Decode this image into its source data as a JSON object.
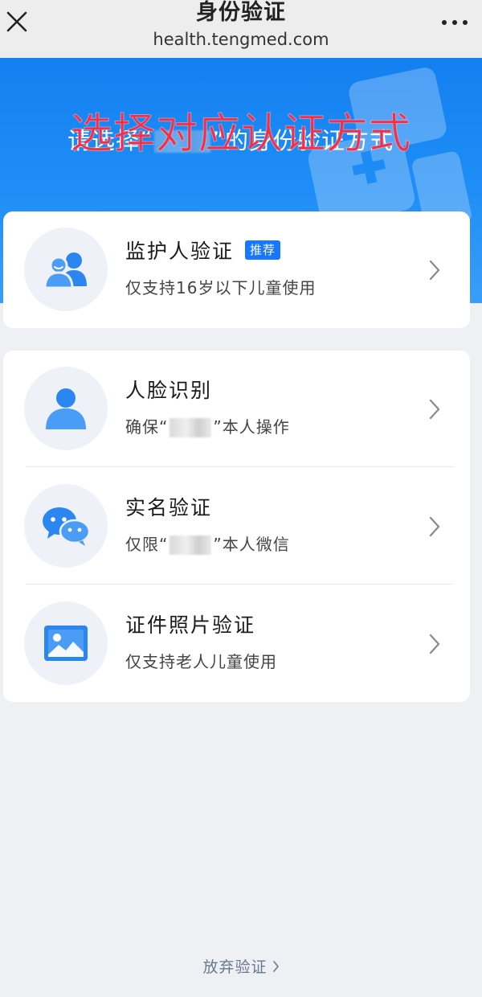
{
  "nav": {
    "title": "身份验证",
    "url": "health.tengmed.com"
  },
  "banner": {
    "subtitle_pre": "请选择“",
    "subtitle_post": "”的身份验证方式",
    "overlay_text": "选择对应认证方式"
  },
  "options": [
    {
      "title": "监护人验证",
      "badge": "推荐",
      "desc": "仅支持16岁以下儿童使用",
      "icon": "guardian-icon"
    },
    {
      "title": "人脸识别",
      "desc_pre": "确保“",
      "desc_post": "”本人操作",
      "icon": "face-icon"
    },
    {
      "title": "实名验证",
      "desc_pre": "仅限“",
      "desc_post": "”本人微信",
      "icon": "wechat-icon"
    },
    {
      "title": "证件照片验证",
      "desc": "仅支持老人儿童使用",
      "icon": "id-photo-icon"
    }
  ],
  "footer": {
    "abandon_label": "放弃验证"
  },
  "colors": {
    "brand_blue": "#1677ff",
    "banner_blue": "#1f8ef6",
    "overlay_red": "#f0304a",
    "icon_blue": "#2b86f0"
  }
}
